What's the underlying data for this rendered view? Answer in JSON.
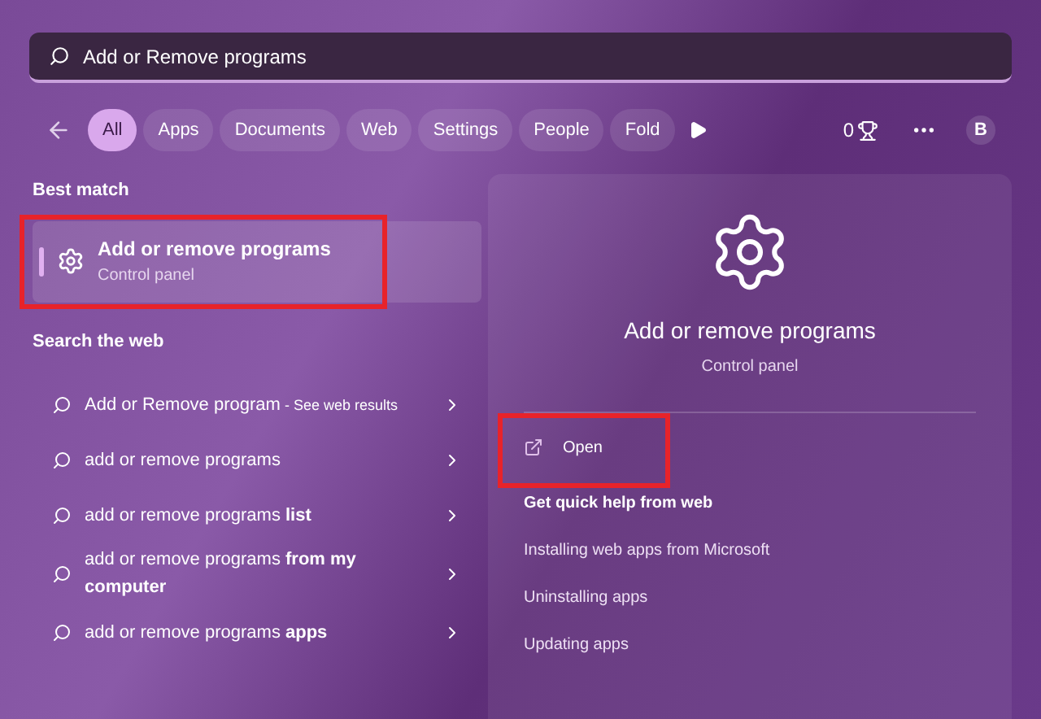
{
  "search": {
    "value": "Add or Remove programs"
  },
  "filters": [
    {
      "label": "All",
      "selected": true
    },
    {
      "label": "Apps",
      "selected": false
    },
    {
      "label": "Documents",
      "selected": false
    },
    {
      "label": "Web",
      "selected": false
    },
    {
      "label": "Settings",
      "selected": false
    },
    {
      "label": "People",
      "selected": false
    },
    {
      "label": "Fold",
      "selected": false
    }
  ],
  "rewards": {
    "points": "0"
  },
  "account": {
    "initial": "B"
  },
  "best_match": {
    "heading": "Best match",
    "title": "Add or remove programs",
    "subtitle": "Control panel",
    "selected": true,
    "highlighted": true
  },
  "web": {
    "heading": "Search the web",
    "items": [
      {
        "text": "Add or Remove program",
        "suffix": "- See web results"
      },
      {
        "text": "add or remove programs"
      },
      {
        "text": "add or remove programs **list**"
      },
      {
        "text": "add or remove programs **from my computer**"
      },
      {
        "text": "add or remove programs **apps**"
      }
    ]
  },
  "detail": {
    "title": "Add or remove programs",
    "subtitle": "Control panel",
    "open": {
      "label": "Open",
      "highlighted": true
    },
    "help_heading": "Get quick help from web",
    "help_links": [
      "Installing web apps from Microsoft",
      "Uninstalling apps",
      "Updating apps"
    ]
  }
}
